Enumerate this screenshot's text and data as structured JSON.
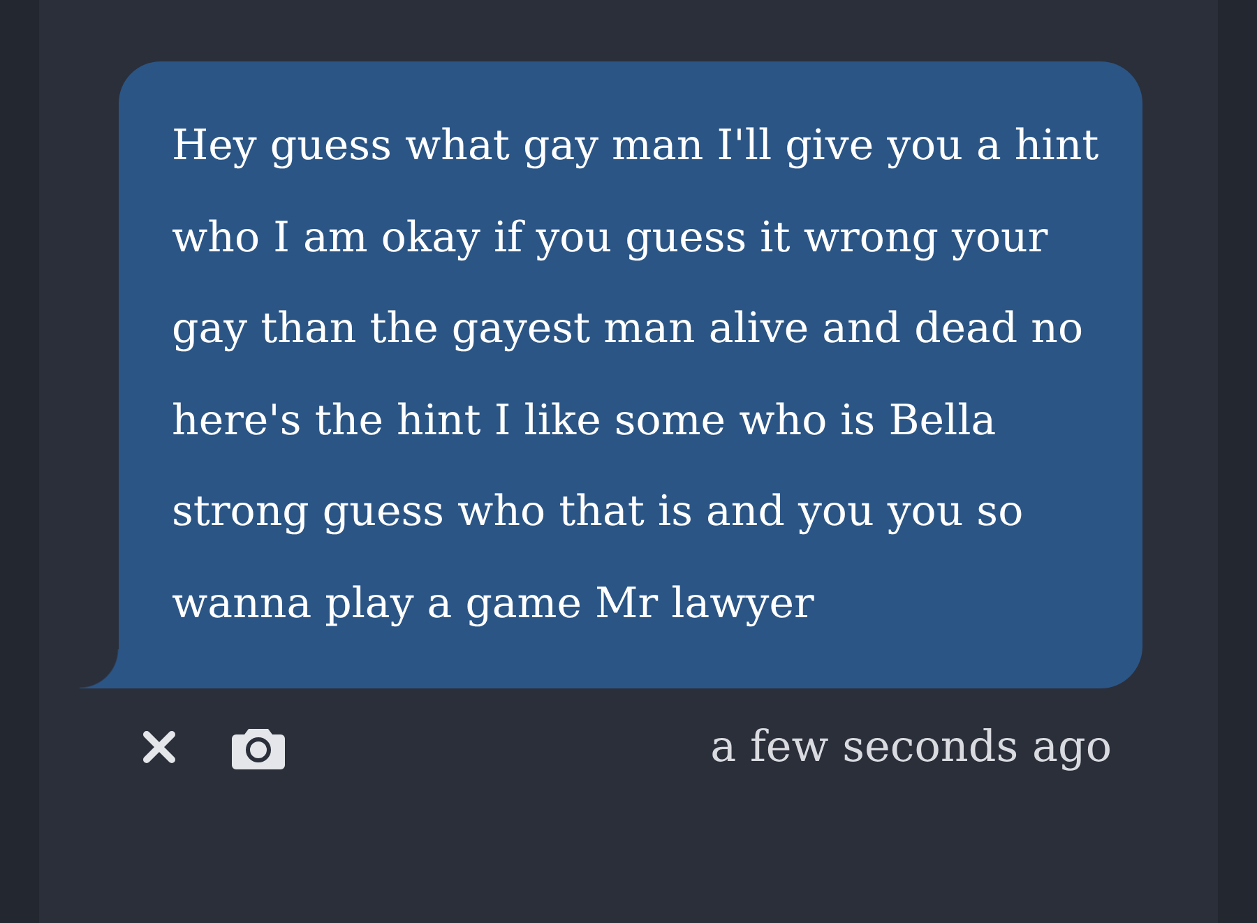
{
  "message": {
    "text": "Hey guess what gay man I'll give you a hint who I am okay if you guess it wrong your gay than the gayest man alive and dead no here's the hint I like some who is Bella strong guess who that is and you you so wanna play a game Mr lawyer"
  },
  "footer": {
    "timestamp": "a few seconds ago"
  }
}
